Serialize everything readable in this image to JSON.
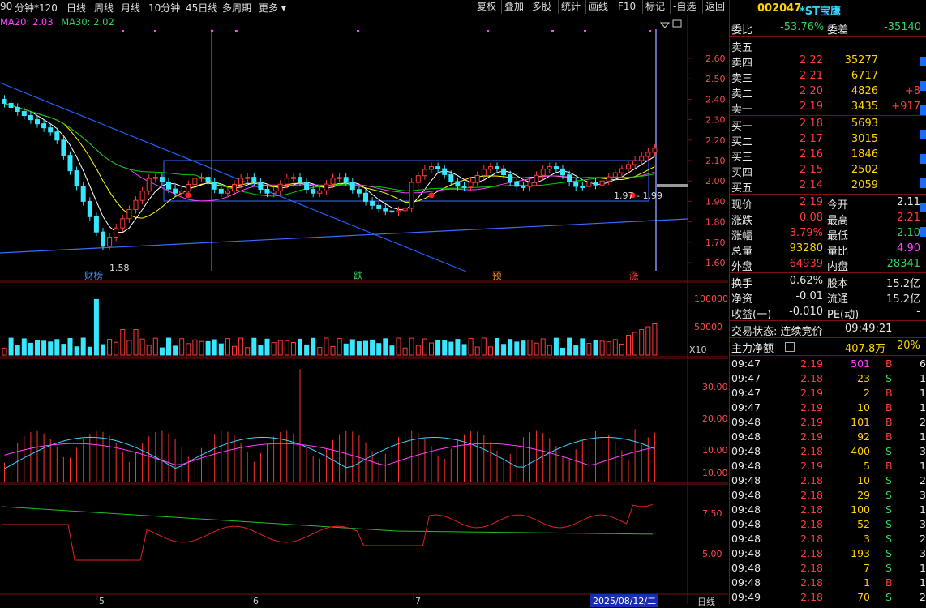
{
  "toolbar": {
    "left_items": [
      "90",
      "分钟*120",
      "日线",
      "周线",
      "月线",
      "10分钟",
      "45日线",
      "多周期",
      "更多 ▾"
    ],
    "right_buttons": [
      "复权",
      "叠加",
      "多股",
      "统计",
      "画线",
      "F10",
      "标记",
      "-自选",
      "返回"
    ]
  },
  "ma_legend": {
    "ma20": "MA20: 2.03",
    "ma30": "MA30: 2.02"
  },
  "price_axis": [
    "2.60",
    "2.50",
    "2.40",
    "2.30",
    "2.20",
    "2.10",
    "2.00",
    "1.90",
    "1.80",
    "1.70",
    "1.60"
  ],
  "annotations": {
    "low_label": "1.58",
    "range_label": "1.97 - 1.99"
  },
  "event_labels": [
    {
      "text": "财榜",
      "color": "#4aa0ff"
    },
    {
      "text": "跌",
      "color": "#32d25a"
    },
    {
      "text": "预",
      "color": "#ff9a30"
    },
    {
      "text": "涨",
      "color": "#ff4040"
    }
  ],
  "volume_axis": [
    "100000",
    "50000"
  ],
  "volume_unit": "X10",
  "indicator1_axis": [
    "30.00",
    "20.00",
    "10.00"
  ],
  "indicator2_axis": [
    "10.00",
    "7.50",
    "5.00"
  ],
  "date_axis": {
    "labels": [
      "5",
      "6",
      "7"
    ],
    "current_date": "2025/08/12/二",
    "period": "日线"
  },
  "stock": {
    "code": "002047",
    "name": "*ST宝鹰"
  },
  "order_ratio": {
    "label1": "委比",
    "value1": "-53.76%",
    "label2": "委差",
    "value2": "-35140"
  },
  "asks": [
    {
      "label": "卖五",
      "price": "",
      "vol": "",
      "chg": ""
    },
    {
      "label": "卖四",
      "price": "2.22",
      "vol": "35277",
      "chg": ""
    },
    {
      "label": "卖三",
      "price": "2.21",
      "vol": "6717",
      "chg": ""
    },
    {
      "label": "卖二",
      "price": "2.20",
      "vol": "4826",
      "chg": "+8"
    },
    {
      "label": "卖一",
      "price": "2.19",
      "vol": "3435",
      "chg": "+917"
    }
  ],
  "bids": [
    {
      "label": "买一",
      "price": "2.18",
      "vol": "5693"
    },
    {
      "label": "买二",
      "price": "2.17",
      "vol": "3015"
    },
    {
      "label": "买三",
      "price": "2.16",
      "vol": "1846"
    },
    {
      "label": "买四",
      "price": "2.15",
      "vol": "2502"
    },
    {
      "label": "买五",
      "price": "2.14",
      "vol": "2059"
    }
  ],
  "quote": [
    {
      "l1": "现价",
      "v1": "2.19",
      "c1": "red",
      "l2": "今开",
      "v2": "2.11",
      "c2": "white"
    },
    {
      "l1": "涨跌",
      "v1": "0.08",
      "c1": "red",
      "l2": "最高",
      "v2": "2.21",
      "c2": "red"
    },
    {
      "l1": "涨幅",
      "v1": "3.79%",
      "c1": "red",
      "l2": "最低",
      "v2": "2.10",
      "c2": "green"
    },
    {
      "l1": "总量",
      "v1": "93280",
      "c1": "yellow",
      "l2": "量比",
      "v2": "4.90",
      "c2": "mag"
    },
    {
      "l1": "外盘",
      "v1": "64939",
      "c1": "red",
      "l2": "内盘",
      "v2": "28341",
      "c2": "green"
    }
  ],
  "fundamentals": [
    {
      "l1": "换手",
      "v1": "0.62%",
      "l2": "股本",
      "v2": "15.2亿"
    },
    {
      "l1": "净资",
      "v1": "-0.01",
      "l2": "流通",
      "v2": "15.2亿"
    },
    {
      "l1": "收益(一)",
      "v1": "-0.010",
      "l2": "PE(动)",
      "v2": "-"
    }
  ],
  "trade_status": {
    "label": "交易状态: 连续竞价",
    "time": "09:49:21"
  },
  "main_flow": {
    "label": "主力净额",
    "value": "407.8万",
    "pct": "20%"
  },
  "ticks": [
    {
      "t": "09:47",
      "p": "2.19",
      "v": "501",
      "s": "B",
      "n": "6",
      "pc": "red",
      "vc": "mag"
    },
    {
      "t": "09:47",
      "p": "2.18",
      "v": "23",
      "s": "S",
      "n": "1",
      "pc": "red",
      "vc": "yellow"
    },
    {
      "t": "09:47",
      "p": "2.19",
      "v": "2",
      "s": "B",
      "n": "1",
      "pc": "red",
      "vc": "yellow"
    },
    {
      "t": "09:47",
      "p": "2.19",
      "v": "10",
      "s": "B",
      "n": "1",
      "pc": "red",
      "vc": "yellow"
    },
    {
      "t": "09:48",
      "p": "2.19",
      "v": "101",
      "s": "B",
      "n": "2",
      "pc": "red",
      "vc": "yellow"
    },
    {
      "t": "09:48",
      "p": "2.19",
      "v": "92",
      "s": "B",
      "n": "1",
      "pc": "red",
      "vc": "yellow"
    },
    {
      "t": "09:48",
      "p": "2.18",
      "v": "400",
      "s": "S",
      "n": "3",
      "pc": "red",
      "vc": "yellow"
    },
    {
      "t": "09:48",
      "p": "2.19",
      "v": "5",
      "s": "B",
      "n": "1",
      "pc": "red",
      "vc": "yellow"
    },
    {
      "t": "09:48",
      "p": "2.18",
      "v": "10",
      "s": "S",
      "n": "2",
      "pc": "red",
      "vc": "yellow"
    },
    {
      "t": "09:48",
      "p": "2.18",
      "v": "29",
      "s": "S",
      "n": "3",
      "pc": "red",
      "vc": "yellow"
    },
    {
      "t": "09:48",
      "p": "2.18",
      "v": "100",
      "s": "S",
      "n": "1",
      "pc": "red",
      "vc": "yellow"
    },
    {
      "t": "09:48",
      "p": "2.18",
      "v": "52",
      "s": "S",
      "n": "3",
      "pc": "red",
      "vc": "yellow"
    },
    {
      "t": "09:48",
      "p": "2.18",
      "v": "3",
      "s": "S",
      "n": "2",
      "pc": "red",
      "vc": "yellow"
    },
    {
      "t": "09:48",
      "p": "2.18",
      "v": "193",
      "s": "S",
      "n": "3",
      "pc": "red",
      "vc": "yellow"
    },
    {
      "t": "09:48",
      "p": "2.18",
      "v": "7",
      "s": "S",
      "n": "1",
      "pc": "red",
      "vc": "yellow"
    },
    {
      "t": "09:48",
      "p": "2.18",
      "v": "1",
      "s": "B",
      "n": "1",
      "pc": "red",
      "vc": "yellow"
    },
    {
      "t": "09:49",
      "p": "2.18",
      "v": "70",
      "s": "S",
      "n": "2",
      "pc": "red",
      "vc": "yellow"
    }
  ],
  "colors": {
    "up": "#ff3b3b",
    "down": "#37e6ff",
    "ma5": "#ffffff",
    "ma10": "#ffff00",
    "ma20": "#ff40ff",
    "ma30": "#00d000",
    "grid": "#7a1010"
  }
}
